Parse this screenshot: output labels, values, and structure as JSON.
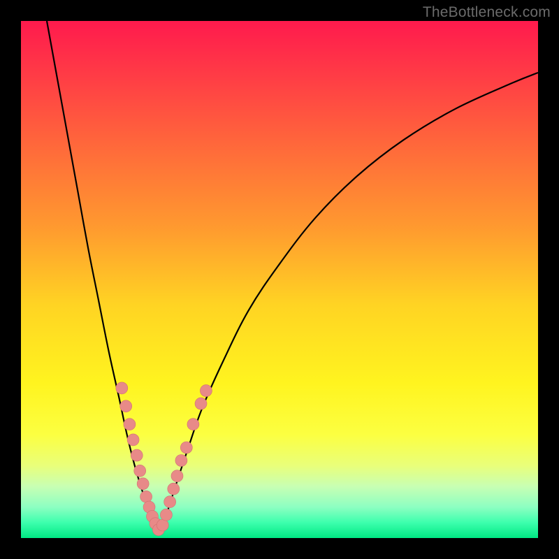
{
  "watermark": "TheBottleneck.com",
  "frame": {
    "outer_size": 800,
    "border": 30,
    "inner_origin": 30,
    "inner_size": 740
  },
  "colors": {
    "black": "#000000",
    "curve": "#000000",
    "marker_fill": "#e88a88",
    "marker_stroke": "#d07270",
    "gradient_stops": [
      {
        "offset": 0.0,
        "color": "#ff1a4d"
      },
      {
        "offset": 0.1,
        "color": "#ff3a46"
      },
      {
        "offset": 0.25,
        "color": "#ff6b3a"
      },
      {
        "offset": 0.4,
        "color": "#ff9a2f"
      },
      {
        "offset": 0.55,
        "color": "#ffd423"
      },
      {
        "offset": 0.7,
        "color": "#fff41f"
      },
      {
        "offset": 0.8,
        "color": "#fcff41"
      },
      {
        "offset": 0.86,
        "color": "#e9ff7a"
      },
      {
        "offset": 0.9,
        "color": "#c8ffb3"
      },
      {
        "offset": 0.94,
        "color": "#8dffc2"
      },
      {
        "offset": 0.97,
        "color": "#3dffad"
      },
      {
        "offset": 1.0,
        "color": "#00e884"
      }
    ]
  },
  "chart_data": {
    "type": "line",
    "title": "",
    "xlabel": "",
    "ylabel": "",
    "xlim": [
      0,
      100
    ],
    "ylim": [
      0,
      100
    ],
    "curve_left": {
      "name": "left-branch",
      "x": [
        5,
        7,
        9,
        11,
        13,
        15,
        17,
        19,
        20.5,
        22,
        23.5,
        24.8,
        25.8,
        26.6
      ],
      "y": [
        100,
        89,
        78,
        67,
        56,
        46,
        36,
        27,
        20,
        14,
        9,
        5,
        2.5,
        1
      ]
    },
    "curve_right": {
      "name": "right-branch",
      "x": [
        26.6,
        27.4,
        28.6,
        30.2,
        32.2,
        35,
        39,
        44,
        50,
        57,
        65,
        74,
        84,
        95,
        100
      ],
      "y": [
        1,
        2.5,
        6,
        11,
        17,
        25,
        34,
        44,
        53,
        62,
        70,
        77,
        83,
        88,
        90
      ]
    },
    "series": [
      {
        "name": "markers",
        "x": [
          19.5,
          20.3,
          21.0,
          21.7,
          22.4,
          23.0,
          23.6,
          24.2,
          24.8,
          25.4,
          26.0,
          26.6,
          27.4,
          28.1,
          28.8,
          29.5,
          30.2,
          31.0,
          32.0,
          33.3,
          34.8,
          35.8
        ],
        "y": [
          29.0,
          25.5,
          22.0,
          19.0,
          16.0,
          13.0,
          10.5,
          8.0,
          6.0,
          4.2,
          2.8,
          1.6,
          2.5,
          4.5,
          7.0,
          9.5,
          12.0,
          15.0,
          17.5,
          22.0,
          26.0,
          28.5
        ]
      }
    ]
  }
}
